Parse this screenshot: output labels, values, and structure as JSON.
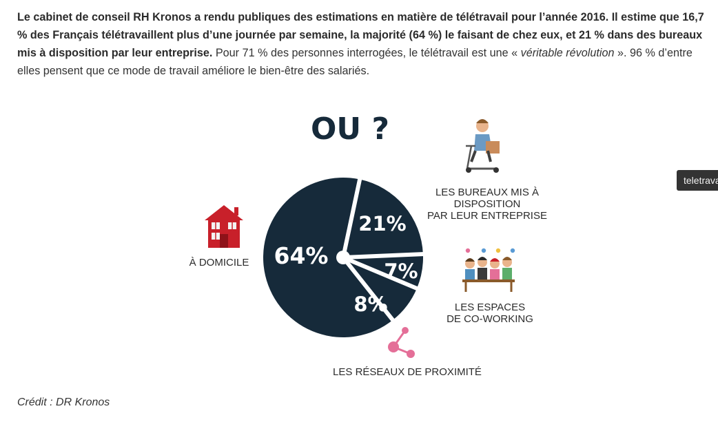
{
  "article": {
    "bold_text": "Le cabinet de conseil RH Kronos a rendu publiques des estimations en matière de télétravail pour l’année 2016. Il estime que 16,7 % des Français télétravaillent plus d’une journée par semaine, la majorité (64 %) le faisant de chez eux, et 21 % dans des bureaux mis à disposition par leur entreprise.",
    "text_1": " Pour 71 % des personnes interrogées, le télétravail est une « ",
    "italic_1": "véritable révolution",
    "text_2": " ». 96 % d’entre elles pensent que ce mode de travail améliore le bien-être des salariés."
  },
  "credit": "Crédit : DR Kronos",
  "tooltip": "teletravail",
  "chart_data": {
    "type": "pie",
    "title": "OU ?",
    "slices": [
      {
        "label": "À DOMICILE",
        "value": 64,
        "value_label": "64%"
      },
      {
        "label": "LES BUREAUX MIS À DISPOSITION PAR LEUR ENTREPRISE",
        "value": 21,
        "value_label": "21%"
      },
      {
        "label": "LES ESPACES DE CO-WORKING",
        "value": 7,
        "value_label": "7%"
      },
      {
        "label": "LES RÉSEAUX DE PROXIMITÉ",
        "value": 8,
        "value_label": "8%"
      }
    ],
    "category_labels": {
      "domicile": "À DOMICILE",
      "bureaux": [
        "LES BUREAUX MIS À",
        "DISPOSITION",
        "PAR LEUR ENTREPRISE"
      ],
      "coworking": [
        "LES ESPACES",
        "DE CO-WORKING"
      ],
      "reseaux": "LES RÉSEAUX DE PROXIMITÉ"
    },
    "colors": {
      "pie": "#162a3a",
      "separator": "#ffffff",
      "house": "#c8202a",
      "network": "#e46f98",
      "label": "#2b2b2b"
    }
  }
}
